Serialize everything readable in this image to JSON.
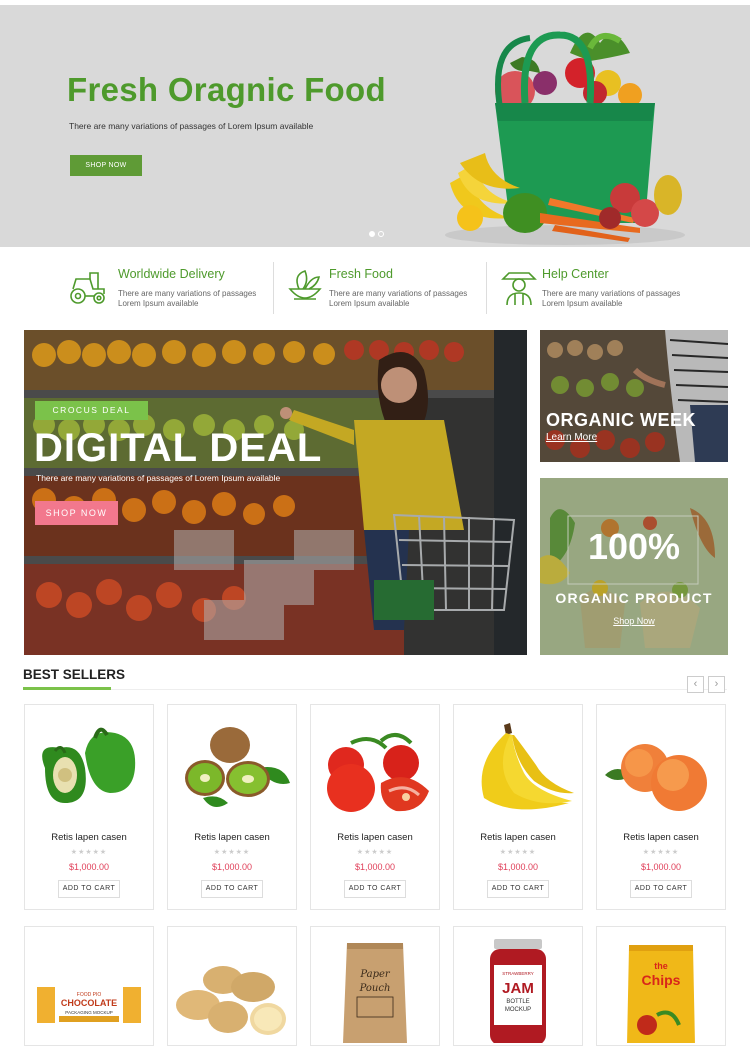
{
  "hero": {
    "title": "Fresh Oragnic Food",
    "subtitle": "There are many variations of passages of Lorem Ipsum available",
    "button": "SHOP NOW",
    "slides": 2,
    "active_slide": 1
  },
  "features": [
    {
      "title": "Worldwide Delivery",
      "line1": "There are many variations of passages",
      "line2": "Lorem Ipsum available",
      "icon": "tractor-icon"
    },
    {
      "title": "Fresh Food",
      "line1": "There are many variations of passages",
      "line2": "Lorem Ipsum available",
      "icon": "leaf-bowl-icon"
    },
    {
      "title": "Help Center",
      "line1": "There are many variations of passages",
      "line2": "Lorem Ipsum available",
      "icon": "farmer-icon"
    }
  ],
  "promo_main": {
    "tag": "CROCUS DEAL",
    "title": "DIGITAL DEAL",
    "subtitle": "There are many variations of passages of Lorem Ipsum available",
    "button": "SHOP NOW"
  },
  "promo_week": {
    "title": "ORGANIC WEEK",
    "link": "Learn More"
  },
  "promo_product": {
    "percent": "100%",
    "title": "ORGANIC PRODUCT",
    "link": "Shop Now"
  },
  "best_sellers": {
    "title": "BEST SELLERS",
    "prev": "‹",
    "next": "›",
    "products": [
      {
        "name": "Retis lapen casen",
        "price": "$1,000.00",
        "cart": "ADD TO CART",
        "stars": "★★★★★",
        "image": "green-pepper"
      },
      {
        "name": "Retis lapen casen",
        "price": "$1,000.00",
        "cart": "ADD TO CART",
        "stars": "★★★★★",
        "image": "kiwi"
      },
      {
        "name": "Retis lapen casen",
        "price": "$1,000.00",
        "cart": "ADD TO CART",
        "stars": "★★★★★",
        "image": "tomato"
      },
      {
        "name": "Retis lapen casen",
        "price": "$1,000.00",
        "cart": "ADD TO CART",
        "stars": "★★★★★",
        "image": "banana"
      },
      {
        "name": "Retis lapen casen",
        "price": "$1,000.00",
        "cart": "ADD TO CART",
        "stars": "★★★★★",
        "image": "peach"
      }
    ],
    "row2_images": [
      "chocolate-bar",
      "potatoes",
      "paper-pouch",
      "jam-bottle",
      "chips-bag"
    ]
  },
  "row2_labels": {
    "chocolate_top": "FOOD PIO",
    "chocolate": "CHOCOLATE",
    "chocolate_sub": "PACKAGING MOCKUP",
    "pouch1": "Paper",
    "pouch2": "Pouch",
    "jam_brand": "STRAWBERRY",
    "jam": "JAM",
    "jam_sub1": "BOTTLE",
    "jam_sub2": "MOCKUP",
    "chips1": "the",
    "chips2": "Chips"
  },
  "colors": {
    "brand_green": "#4e9a2c",
    "accent_green": "#7bc24a",
    "pink": "#f2788d",
    "price_red": "#e0405a"
  }
}
